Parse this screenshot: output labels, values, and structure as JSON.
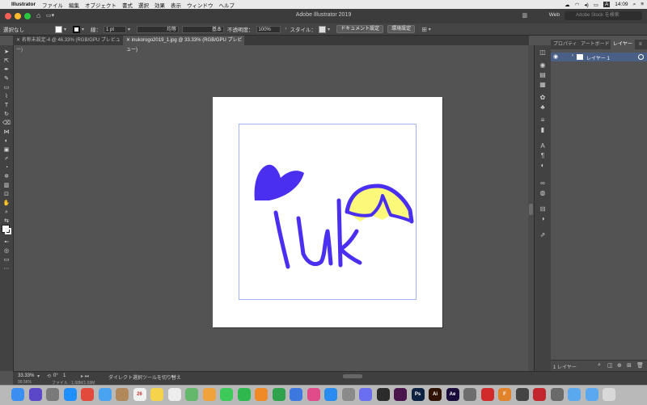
{
  "menubar": {
    "apple": "",
    "app_name": "Illustrator",
    "items": [
      "ファイル",
      "編集",
      "オブジェクト",
      "書式",
      "選択",
      "効果",
      "表示",
      "ウィンドウ",
      "ヘルプ"
    ],
    "clock": "14:09"
  },
  "titlebar": {
    "title": "Adobe Illustrator 2019",
    "workspace": "Web",
    "search_placeholder": "Adobe Stock を検索"
  },
  "controlbar": {
    "selection": "選択なし",
    "stroke_label": "線：",
    "stroke_weight": "1 pt",
    "profile_label": "均等",
    "brush_label": "基本",
    "opacity_label": "不透明度：",
    "opacity_value": "100%",
    "style_label": "スタイル：",
    "doc_setup_button": "ドキュメント設定",
    "prefs_button": "環境設定"
  },
  "tabs": [
    "名称未設定-4 @ 46.33% (RGB/GPU プレビュー)",
    "inukorogo2019_1.jpg @ 33.33% (RGB/GPU プレビュー)"
  ],
  "panel": {
    "tabs": [
      "プロパティ",
      "アートボード",
      "レイヤー"
    ],
    "layer_name": "レイヤー 1",
    "footer": "1 レイヤー"
  },
  "statusbar": {
    "zoom": "33.33%",
    "artboard_num": "1",
    "tool_hint": "ダイレクト選択ツールを切り替え",
    "angle": "0°",
    "zoom2": "99.56%",
    "file_info": "ファイル : 1.68M/1.69M"
  },
  "artwork": {
    "blue": "#4a2ff0",
    "yellow": "#fbf87a",
    "text": "Ink"
  },
  "colors": {
    "ui_dark": "#535353",
    "panel_selected": "#4a5f85"
  },
  "dock": {
    "items": [
      {
        "icon": "finder-icon",
        "label": "",
        "color": "#3b8ff2"
      },
      {
        "icon": "siri-icon",
        "label": "",
        "color": "#5a48c8"
      },
      {
        "icon": "launchpad-icon",
        "label": "",
        "color": "#7a7a7a"
      },
      {
        "icon": "safari-icon",
        "label": "",
        "color": "#1e90ff"
      },
      {
        "icon": "chrome-icon",
        "label": "",
        "color": "#e24a3b"
      },
      {
        "icon": "mail-icon",
        "label": "",
        "color": "#4aa3f0"
      },
      {
        "icon": "contacts-icon",
        "label": "",
        "color": "#b0885a"
      },
      {
        "icon": "calendar-icon",
        "label": "26",
        "color": "#f2f2f2"
      },
      {
        "icon": "notes-icon",
        "label": "",
        "color": "#f5d34a"
      },
      {
        "icon": "reminders-icon",
        "label": "",
        "color": "#ededed"
      },
      {
        "icon": "maps-icon",
        "label": "",
        "color": "#63b86b"
      },
      {
        "icon": "photos-icon",
        "label": "",
        "color": "#f0a33a"
      },
      {
        "icon": "messages-icon",
        "label": "",
        "color": "#3ec95b"
      },
      {
        "icon": "facetime-icon",
        "label": "",
        "color": "#2fb84e"
      },
      {
        "icon": "pages-icon",
        "label": "",
        "color": "#f08a24"
      },
      {
        "icon": "numbers-icon",
        "label": "",
        "color": "#2fa24d"
      },
      {
        "icon": "keynote-icon",
        "label": "",
        "color": "#3d78e0"
      },
      {
        "icon": "itunes-icon",
        "label": "",
        "color": "#e24b8a"
      },
      {
        "icon": "appstore-icon",
        "label": "",
        "color": "#2a8cf0"
      },
      {
        "icon": "preferences-icon",
        "label": "",
        "color": "#8a8a8a"
      },
      {
        "icon": "discord-icon",
        "label": "",
        "color": "#6a6ef0"
      },
      {
        "icon": "terminal-icon",
        "label": "",
        "color": "#2b2b2b"
      },
      {
        "icon": "slack-icon",
        "label": "",
        "color": "#4a154b"
      },
      {
        "icon": "photoshop-icon",
        "label": "Ps",
        "color": "#0c2240"
      },
      {
        "icon": "illustrator-icon",
        "label": "Ai",
        "color": "#2f1200"
      },
      {
        "icon": "aftereffects-icon",
        "label": "Ae",
        "color": "#1a0b3a"
      },
      {
        "icon": "image-icon",
        "label": "",
        "color": "#6d6d6d"
      },
      {
        "icon": "audio-icon",
        "label": "",
        "color": "#d22a2a"
      },
      {
        "icon": "fontbook-icon",
        "label": "F",
        "color": "#e0832a"
      },
      {
        "icon": "music-icon",
        "label": "",
        "color": "#444444"
      },
      {
        "icon": "acrobat-icon",
        "label": "",
        "color": "#c4262e"
      },
      {
        "icon": "finder-window-icon",
        "label": "",
        "color": "#6a6a6a"
      },
      {
        "icon": "folder-icon",
        "label": "",
        "color": "#5aa9f0"
      },
      {
        "icon": "folder-icon-2",
        "label": "",
        "color": "#5aa9f0"
      },
      {
        "icon": "trash-icon",
        "label": "",
        "color": "#d9d9d9"
      }
    ]
  }
}
